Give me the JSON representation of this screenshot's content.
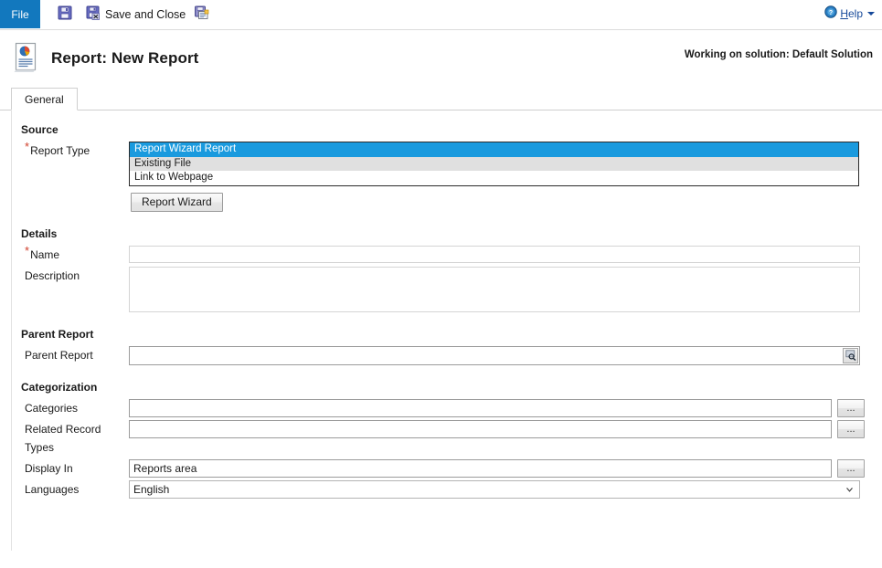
{
  "ribbon": {
    "file_tab": "File",
    "commands": [
      {
        "icon": "save-icon",
        "label": ""
      },
      {
        "icon": "save-and-close-icon",
        "label": "Save and Close"
      },
      {
        "icon": "save-as-new-icon",
        "label": ""
      }
    ],
    "help": {
      "label_prefix": "",
      "accelerator": "H",
      "label_suffix": "elp",
      "icon": "help-icon"
    }
  },
  "header": {
    "icon": "report-document-icon",
    "title": "Report: New Report",
    "solution_status": "Working on solution: Default Solution"
  },
  "tabs": [
    {
      "label": "General",
      "active": true
    }
  ],
  "form": {
    "sections": {
      "source": {
        "title": "Source",
        "report_type": {
          "label": "Report Type",
          "required": true,
          "options": [
            "Report Wizard Report",
            "Existing File",
            "Link to Webpage"
          ],
          "selected": "Report Wizard Report"
        },
        "wizard_button": "Report Wizard"
      },
      "details": {
        "title": "Details",
        "name": {
          "label": "Name",
          "required": true,
          "value": "",
          "placeholder": ""
        },
        "description": {
          "label": "Description",
          "required": false,
          "value": "",
          "placeholder": ""
        }
      },
      "parent_report": {
        "title": "Parent Report",
        "field": {
          "label": "Parent Report",
          "required": false,
          "value": "",
          "placeholder": "",
          "lookup_icon": "lookup-magnifier-icon"
        }
      },
      "categorization": {
        "title": "Categorization",
        "categories": {
          "label": "Categories",
          "value": "",
          "browse": "..."
        },
        "related_record_types": {
          "label": "Related Record Types",
          "value": "",
          "browse": "..."
        },
        "display_in": {
          "label": "Display In",
          "value": "Reports area",
          "browse": "..."
        },
        "languages": {
          "label": "Languages",
          "value": "English",
          "options": [
            "English"
          ]
        }
      }
    }
  },
  "colors": {
    "accent_blue": "#1278be",
    "selection_blue": "#1a9ade",
    "required_red": "#d0402c",
    "link_blue": "#16499a"
  }
}
